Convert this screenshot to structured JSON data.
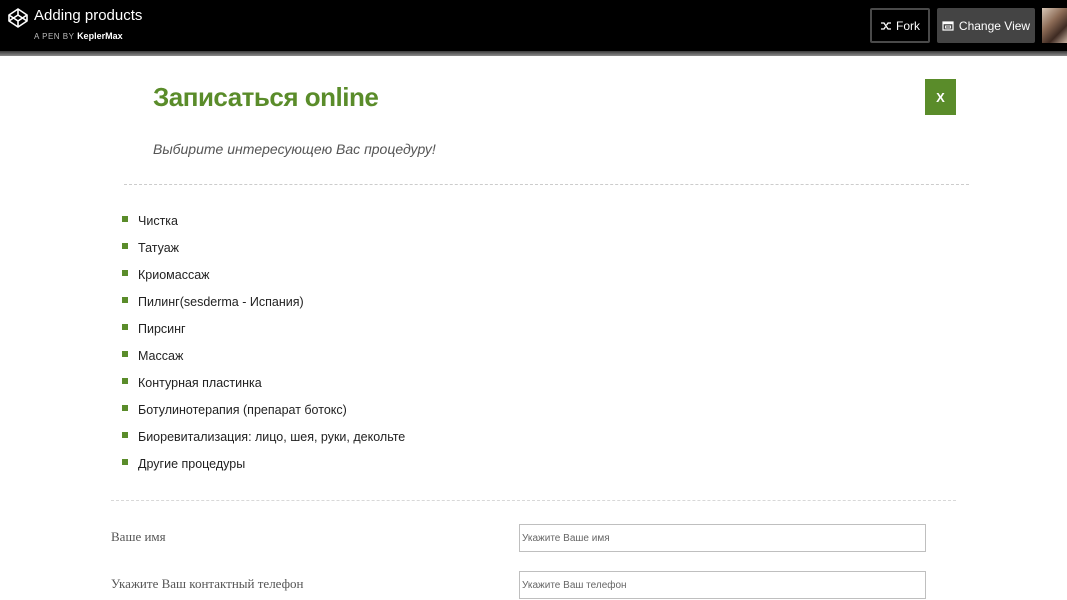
{
  "codepen": {
    "pen_title": "Adding products",
    "pen_by_prefix": "A PEN BY",
    "author": "KeplerMax",
    "fork_label": "Fork",
    "change_view_label": "Change View",
    "icons": {
      "logo": "codepen-logo-icon",
      "fork": "fork-icon",
      "change_view": "change-view-icon"
    }
  },
  "form": {
    "title": "Записаться online",
    "close_label": "X",
    "subtitle": "Выбирите интересующею Вас процедуру!",
    "accent_color": "#5a8c2a",
    "procedures": [
      "Чистка",
      "Татуаж",
      "Криомассаж",
      "Пилинг(sesderma - Испания)",
      "Пирсинг",
      "Массаж",
      "Контурная пластинка",
      "Ботулинотерапия (препарат ботокс)",
      "Биоревитализация: лицо, шея, руки, декольте",
      "Другие процедуры"
    ],
    "name_label": "Ваше имя",
    "name_placeholder": "Укажите Ваше имя",
    "name_value": "",
    "phone_label": "Укажите Ваш контактный телефон",
    "phone_placeholder": "Укажите Ваш телефон",
    "phone_value": ""
  }
}
